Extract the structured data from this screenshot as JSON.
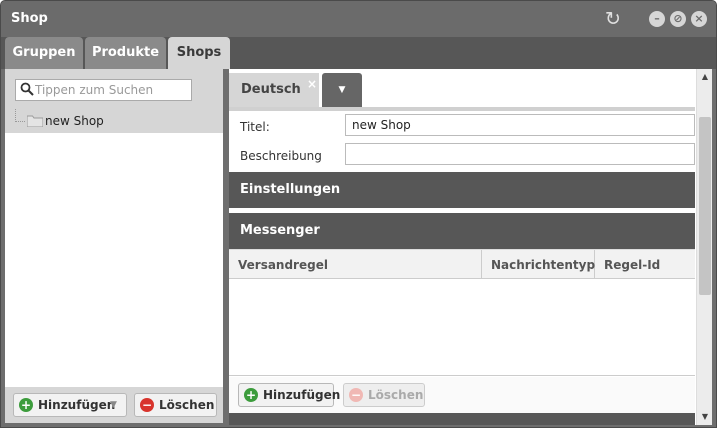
{
  "window": {
    "title": "Shop"
  },
  "tabs": [
    {
      "label": "Gruppen"
    },
    {
      "label": "Produkte"
    },
    {
      "label": "Shops"
    }
  ],
  "search": {
    "placeholder": "Tippen zum Suchen"
  },
  "tree": {
    "items": [
      {
        "label": "new Shop"
      }
    ]
  },
  "left_buttons": {
    "add": "Hinzufügen",
    "delete": "Löschen"
  },
  "language_tab": {
    "label": "Deutsch",
    "close": "×"
  },
  "form": {
    "title_label": "Titel:",
    "title_value": "new Shop",
    "description_label": "Beschreibung",
    "description_value": ""
  },
  "sections": {
    "settings": "Einstellungen",
    "messenger": "Messenger"
  },
  "messenger_grid": {
    "columns": [
      "Versandregel",
      "Nachrichtentyp",
      "Regel-Id"
    ],
    "rows": []
  },
  "grid_buttons": {
    "add": "Hinzufügen",
    "delete": "Löschen"
  },
  "colors": {
    "titlebar": "#6b6b6b",
    "section_header": "#575757",
    "tab_active": "#d6d6d6",
    "add_green": "#3c9c3c",
    "delete_red": "#d8342c"
  }
}
